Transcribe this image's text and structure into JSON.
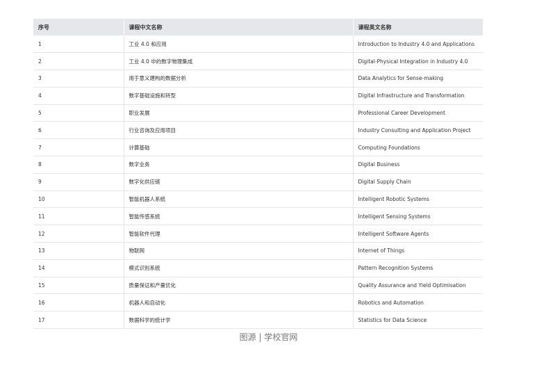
{
  "table": {
    "headers": [
      "序号",
      "课程中文名称",
      "课程英文名称"
    ],
    "rows": [
      [
        "1",
        "工业 4.0 和应用",
        "Introduction to Industry 4.0 and Applications"
      ],
      [
        "2",
        "工业 4.0 中的数字物理集成",
        "Digital-Physical Integration in Industry 4.0"
      ],
      [
        "3",
        "用于意义建构的数据分析",
        "Data Analytics for Sense-making"
      ],
      [
        "4",
        "数字基础设施和转型",
        "Digital Infrastructure and Transformation"
      ],
      [
        "5",
        "职业发展",
        "Professional Career Development"
      ],
      [
        "6",
        "行业咨询及应用项目",
        "Industry Consulting and Application Project"
      ],
      [
        "7",
        "计算基础",
        "Computing Foundations"
      ],
      [
        "8",
        "数字业务",
        "Digital Business"
      ],
      [
        "9",
        "数字化供应链",
        "Digital Supply Chain"
      ],
      [
        "10",
        "智能机器人系统",
        "Intelligent Robotic Systems"
      ],
      [
        "11",
        "智能传感系统",
        "Intelligent Sensing Systems"
      ],
      [
        "12",
        "智能软件代理",
        "Intelligent Software Agents"
      ],
      [
        "13",
        "物联网",
        "Internet of Things"
      ],
      [
        "14",
        "模式识别系统",
        "Pattern Recognition Systems"
      ],
      [
        "15",
        "质量保证和产量优化",
        "Quality Assurance and Yield Optimisation"
      ],
      [
        "16",
        "机器人和自动化",
        "Robotics and Automation"
      ],
      [
        "17",
        "数据科学的统计学",
        "Statistics for Data Science"
      ]
    ]
  },
  "caption": "图源 | 学校官网"
}
